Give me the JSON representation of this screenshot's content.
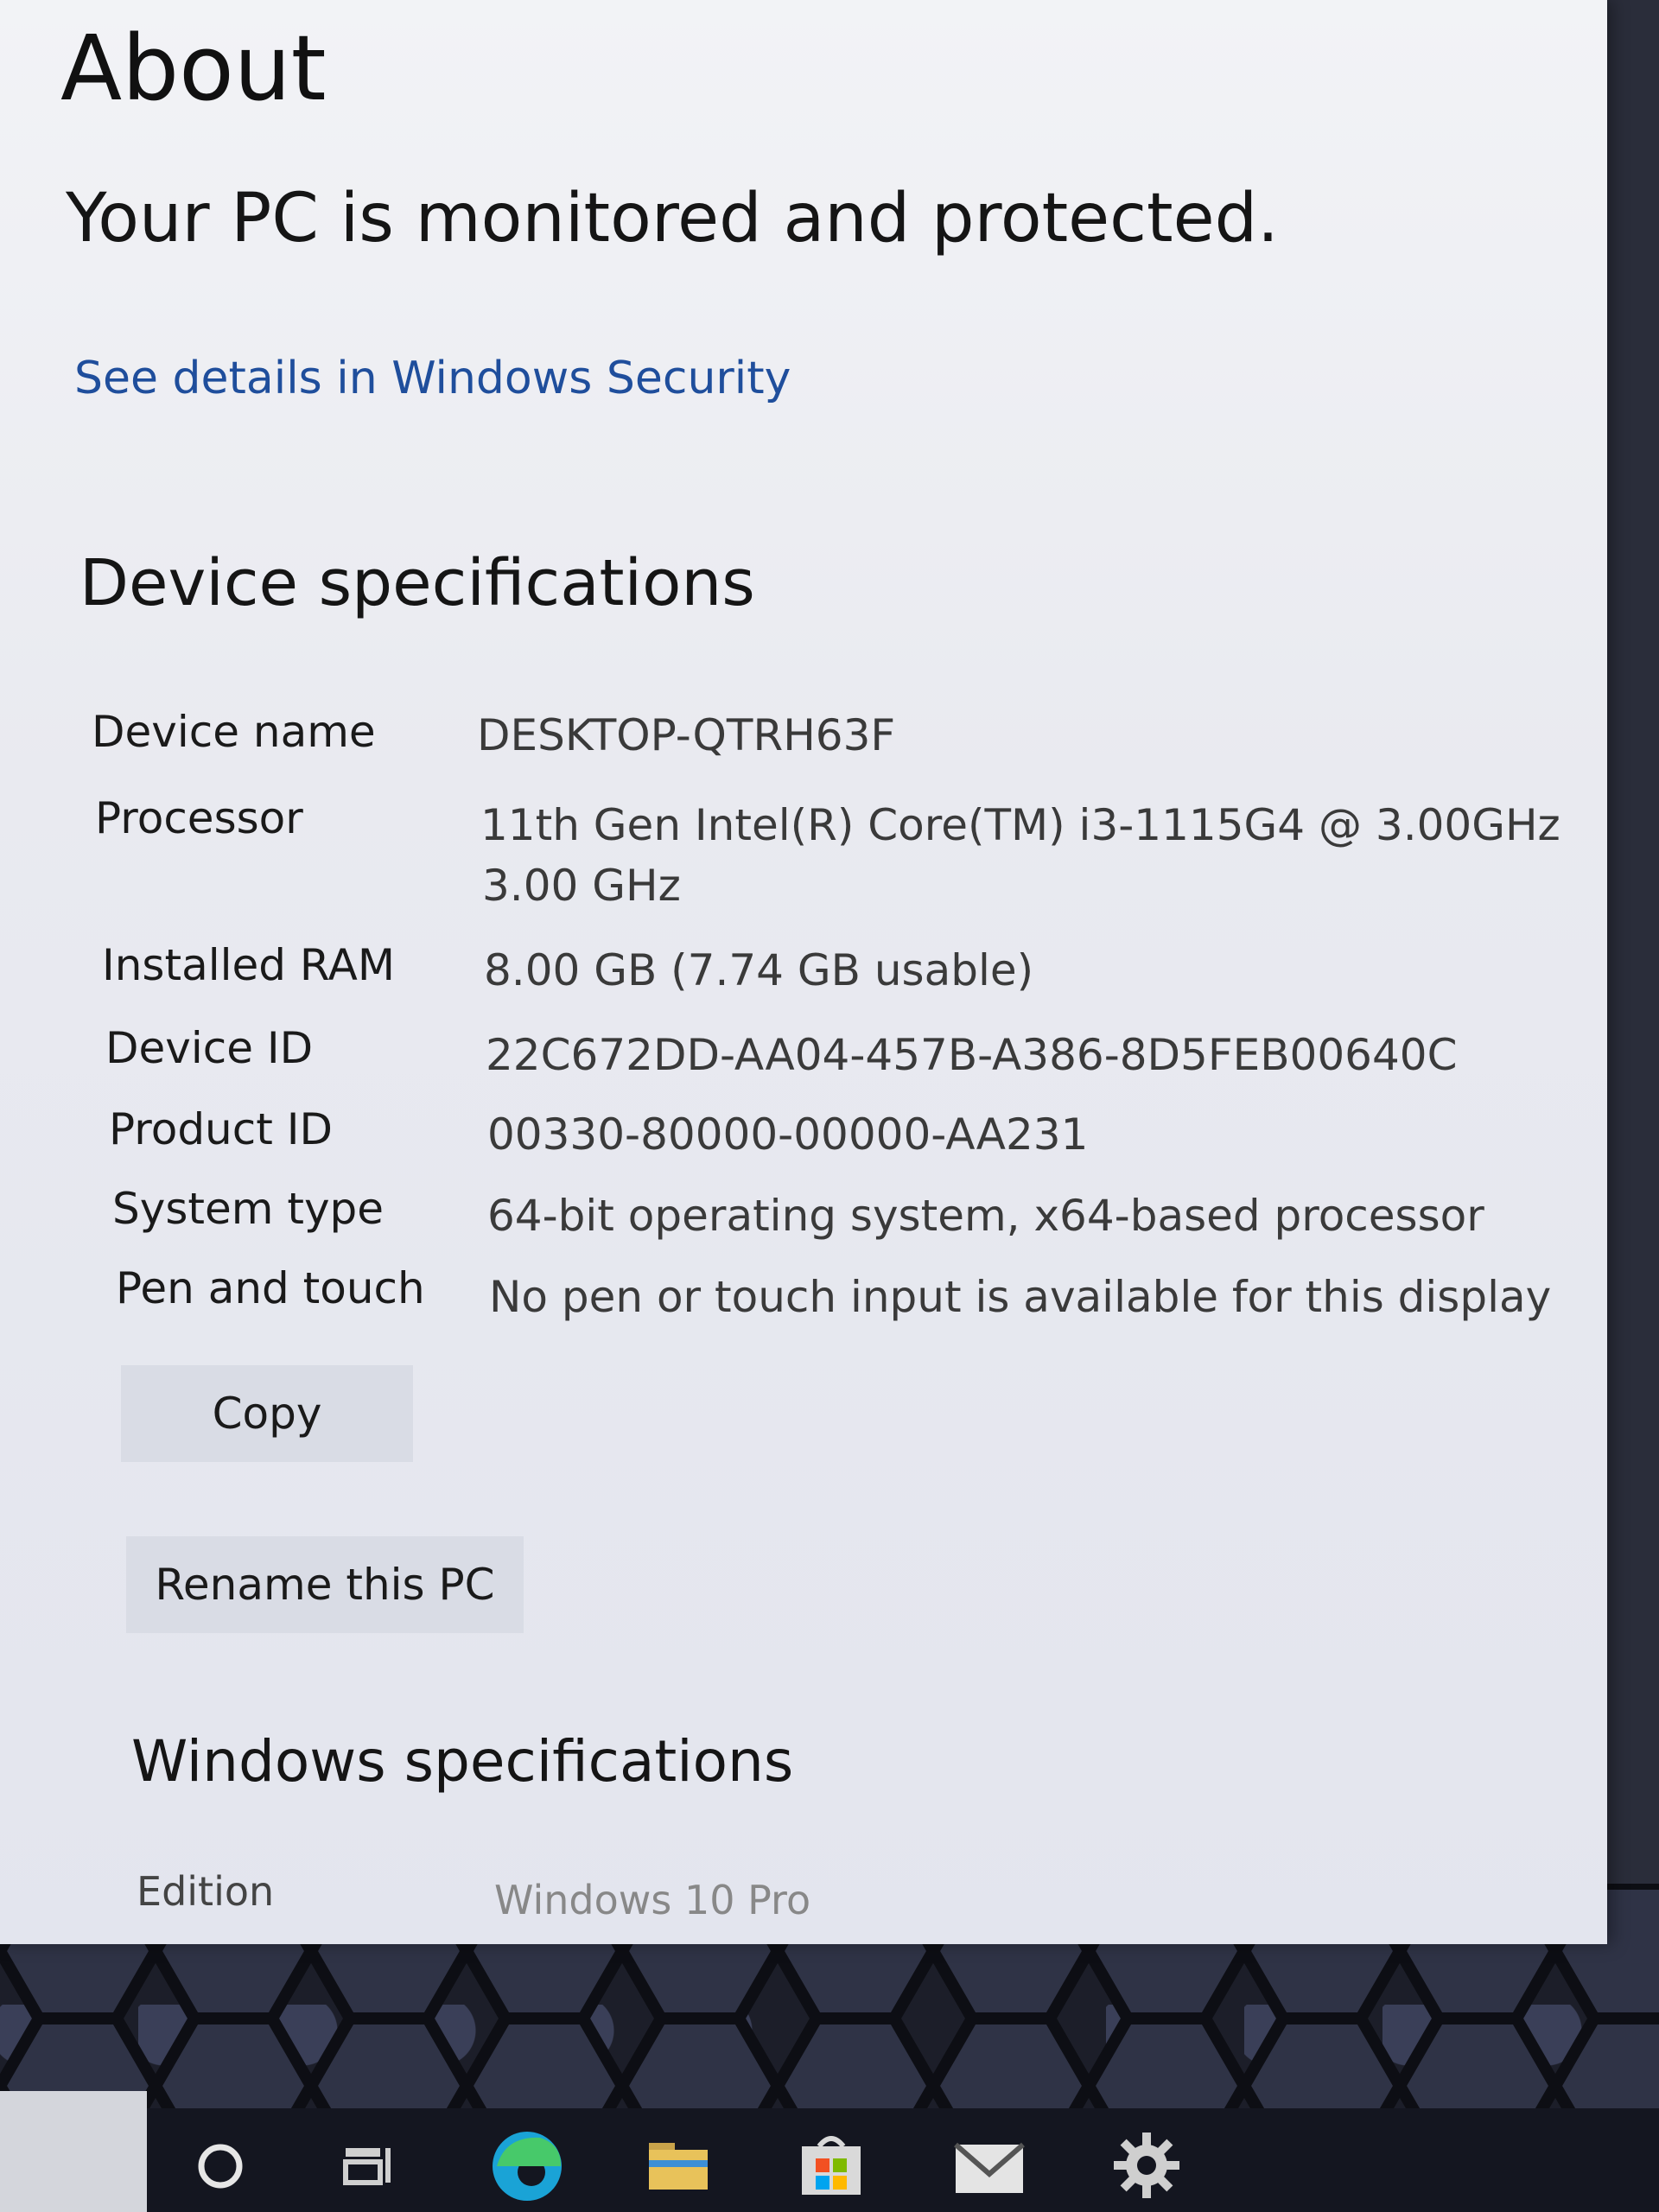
{
  "window": {
    "title": "About",
    "status": "Your PC is monitored and protected.",
    "security_link": "See details in Windows Security"
  },
  "device_specs": {
    "heading": "Device specifications",
    "rows": [
      {
        "label": "Device name",
        "value": "DESKTOP-QTRH63F",
        "value2": ""
      },
      {
        "label": "Processor",
        "value": "11th Gen Intel(R) Core(TM) i3-1115G4 @ 3.00GHz",
        "value2": "3.00 GHz"
      },
      {
        "label": "Installed RAM",
        "value": "8.00 GB (7.74 GB usable)",
        "value2": ""
      },
      {
        "label": "Device ID",
        "value": "22C672DD-AA04-457B-A386-8D5FEB00640C",
        "value2": ""
      },
      {
        "label": "Product ID",
        "value": "00330-80000-00000-AA231",
        "value2": ""
      },
      {
        "label": "System type",
        "value": "64-bit operating system, x64-based processor",
        "value2": ""
      },
      {
        "label": "Pen and touch",
        "value": "No pen or touch input is available for this display",
        "value2": ""
      }
    ],
    "copy_label": "Copy",
    "rename_label": "Rename this PC"
  },
  "windows_specs": {
    "heading": "Windows specifications",
    "edition_label": "Edition",
    "edition_value": "Windows 10 Pro"
  },
  "taskbar": {
    "icons": [
      "search-circle-icon",
      "task-view-icon",
      "edge-browser-icon",
      "file-explorer-icon",
      "microsoft-store-icon",
      "mail-icon",
      "settings-gear-icon"
    ]
  }
}
